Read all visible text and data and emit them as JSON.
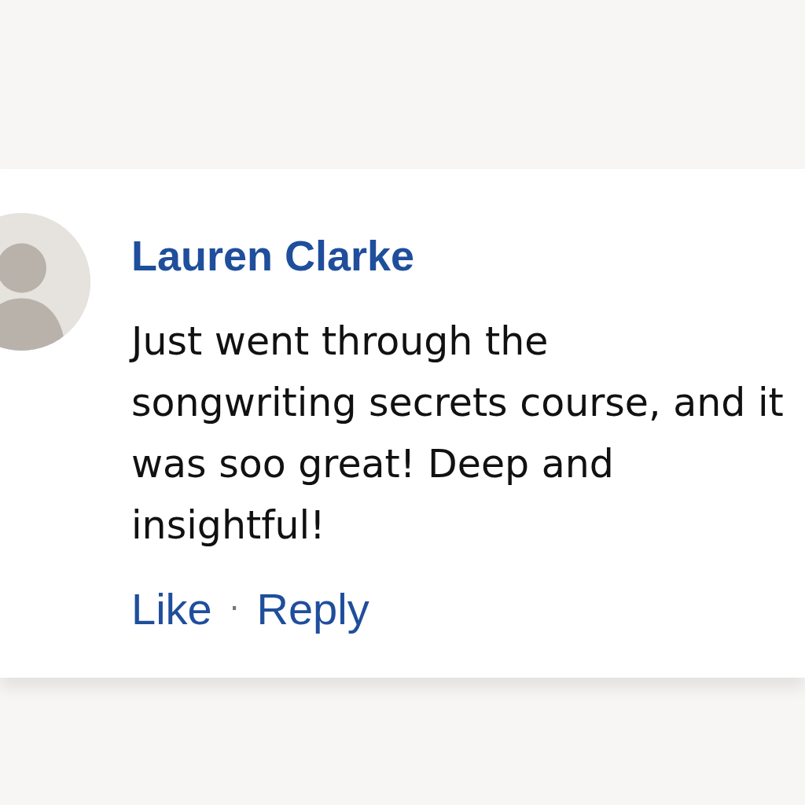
{
  "comment": {
    "author": "Lauren Clarke",
    "text": "Just went through the songwriting secrets course, and it was soo great! Deep and insightful!",
    "actions": [
      {
        "label": "Like"
      },
      {
        "label": "Reply"
      }
    ],
    "separator": "·"
  }
}
